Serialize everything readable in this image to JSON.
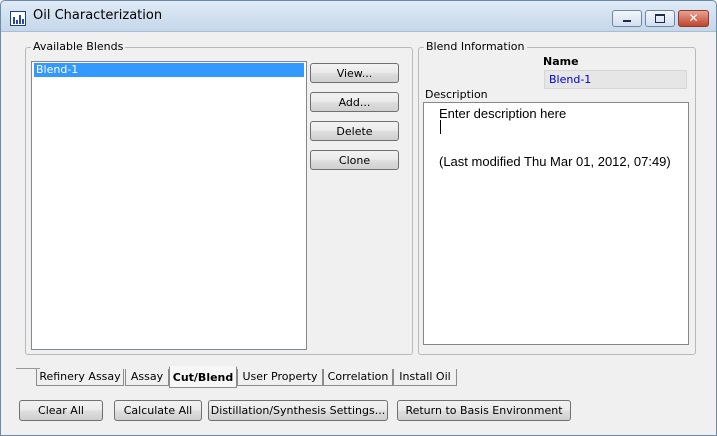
{
  "window": {
    "title": "Oil  Characterization",
    "minimize_label": "_",
    "maximize_label": "□",
    "close_label": "✕"
  },
  "blends": {
    "legend": "Available Blends",
    "items": [
      "Blend-1"
    ],
    "buttons": {
      "view": "View...",
      "add": "Add...",
      "delete": "Delete",
      "clone": "Clone"
    }
  },
  "info": {
    "legend": "Blend  Information",
    "name_label": "Name",
    "name_value": "Blend-1",
    "description_label": "Description",
    "description_lines": [
      "Enter description here",
      "(Last modified Thu Mar 01, 2012, 07:49)"
    ]
  },
  "tabs": [
    {
      "label": "Refinery Assay",
      "active": false
    },
    {
      "label": "Assay",
      "active": false
    },
    {
      "label": "Cut/Blend",
      "active": true
    },
    {
      "label": "User Property",
      "active": false
    },
    {
      "label": "Correlation",
      "active": false
    },
    {
      "label": "Install Oil",
      "active": false
    }
  ],
  "bottom_buttons": {
    "clear_all": "Clear All",
    "calculate_all": "Calculate All",
    "distillation": "Distillation/Synthesis Settings...",
    "return": "Return to Basis Environment"
  },
  "colors": {
    "selection": "#3399ff",
    "name_text": "#0000cc",
    "close_button": "#c0452b"
  }
}
